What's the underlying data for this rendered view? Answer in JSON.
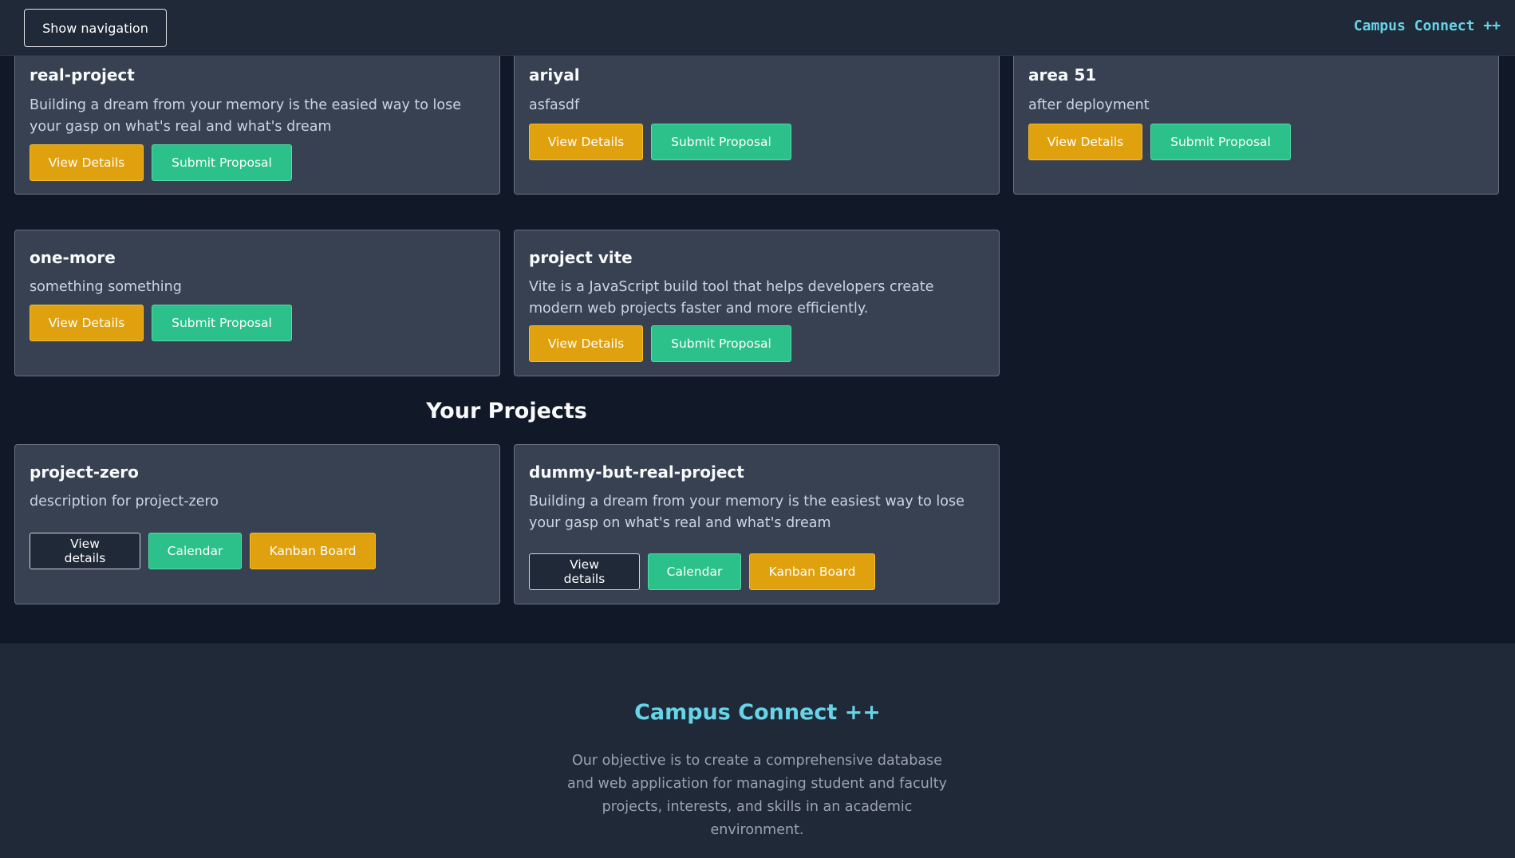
{
  "header": {
    "nav_button_label": "Show navigation",
    "brand": "Campus Connect ++"
  },
  "available_projects": [
    {
      "title": "real-project",
      "description": "Building a dream from your memory is the easied way to lose your gasp on what's real and what's dream",
      "view_label": "View Details",
      "submit_label": "Submit Proposal"
    },
    {
      "title": "ariyal",
      "description": "asfasdf",
      "view_label": "View Details",
      "submit_label": "Submit Proposal"
    },
    {
      "title": "area 51",
      "description": "after deployment",
      "view_label": "View Details",
      "submit_label": "Submit Proposal"
    },
    {
      "title": "one-more",
      "description": "something something",
      "view_label": "View Details",
      "submit_label": "Submit Proposal"
    },
    {
      "title": "project vite",
      "description": "Vite is a JavaScript build tool that helps developers create modern web projects faster and more efficiently.",
      "view_label": "View Details",
      "submit_label": "Submit Proposal"
    }
  ],
  "your_projects": {
    "heading": "Your Projects",
    "items": [
      {
        "title": "project-zero",
        "description": "description for project-zero",
        "view_label": "View details",
        "calendar_label": "Calendar",
        "kanban_label": "Kanban Board"
      },
      {
        "title": "dummy-but-real-project",
        "description": "Building a dream from your memory is the easiest way to lose your gasp on what's real and what's dream",
        "view_label": "View details",
        "calendar_label": "Calendar",
        "kanban_label": "Kanban Board"
      }
    ]
  },
  "footer": {
    "title": "Campus Connect ++",
    "text": "Our objective is to create a comprehensive database and web application for managing student and faculty projects, interests, and skills in an academic environment."
  },
  "colors": {
    "page_bg": "#111827",
    "card_bg": "#374151",
    "accent_yellow": "#e0a10f",
    "accent_green": "#2cc08b",
    "brand_cyan": "#67d4e8"
  }
}
